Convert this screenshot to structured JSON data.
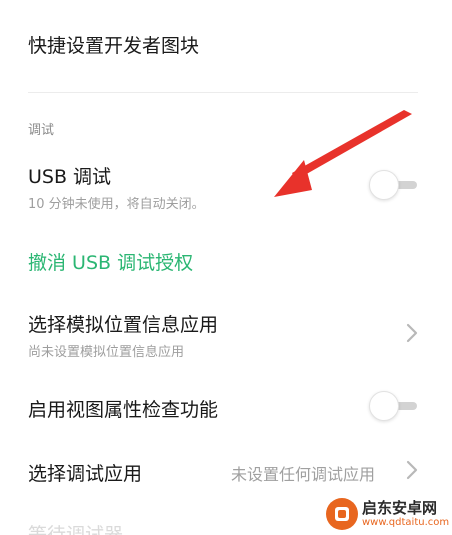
{
  "rows": {
    "quick_tiles": {
      "title": "快捷设置开发者图块"
    },
    "section_debug": {
      "label": "调试"
    },
    "usb_debug": {
      "title": "USB 调试",
      "subtitle": "10 分钟未使用，将自动关闭。",
      "toggle_on": false
    },
    "revoke_usb": {
      "label": "撤消 USB 调试授权"
    },
    "mock_location": {
      "title": "选择模拟位置信息应用",
      "subtitle": "尚未设置模拟位置信息应用"
    },
    "view_attr": {
      "title": "启用视图属性检查功能",
      "toggle_on": false
    },
    "debug_app": {
      "title": "选择调试应用",
      "value": "未设置任何调试应用"
    },
    "wait_debugger": {
      "title": "等待调试器"
    }
  },
  "colors": {
    "accent_green": "#2bb673",
    "arrow_red": "#e8322b",
    "watermark_orange": "#e8661f"
  },
  "watermark": {
    "name": "启东安卓网",
    "url": "www.qdtaitu.com"
  },
  "icons": [
    "chevron-right-icon",
    "red-arrow-annotation",
    "watermark-logo-icon"
  ]
}
